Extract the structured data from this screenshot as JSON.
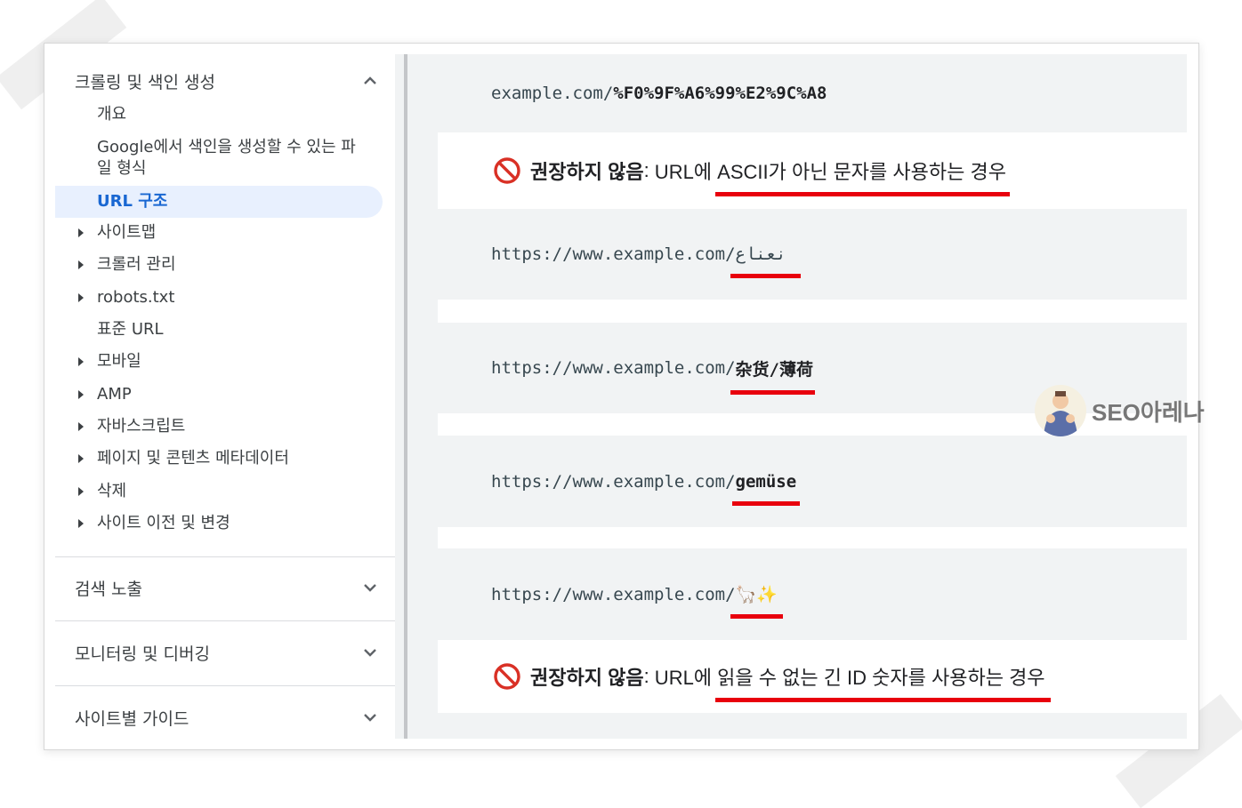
{
  "sidebar": {
    "section_crawl": "크롤링 및 색인 생성",
    "items": [
      {
        "label": "개요"
      },
      {
        "label": "Google에서 색인을 생성할 수 있는 파",
        "label2": "일 형식"
      },
      {
        "label": "URL 구조"
      },
      {
        "label": "사이트맵"
      },
      {
        "label": "크롤러 관리"
      },
      {
        "label": "robots.txt"
      },
      {
        "label": "표준 URL"
      },
      {
        "label": "모바일"
      },
      {
        "label": "AMP"
      },
      {
        "label": "자바스크립트"
      },
      {
        "label": "페이지 및 콘텐츠 메타데이터"
      },
      {
        "label": "삭제"
      },
      {
        "label": "사이트 이전 및 변경"
      }
    ],
    "section_search": "검색 노출",
    "section_monitor": "모니터링 및 디버깅",
    "section_guide": "사이트별 가이드"
  },
  "content": {
    "row1": {
      "prefix": "example.com/",
      "suffix": "%F0%9F%A6%99%E2%9C%A8"
    },
    "warn1": {
      "strong": "권장하지 않음",
      "colon": ":",
      "rest": " URL에 ASCII가 아닌 문자를 사용하는 경우"
    },
    "row2": {
      "prefix": "https://www.example.com/",
      "suffix": "نعناع"
    },
    "row3": {
      "prefix": "https://www.example.com/",
      "suffix": "杂货/薄荷"
    },
    "row4": {
      "prefix": "https://www.example.com/",
      "suffix": "gemüse"
    },
    "row5": {
      "prefix": "https://www.example.com/",
      "suffix": "🦙✨"
    },
    "warn2": {
      "strong": "권장하지 않음",
      "colon": ":",
      "rest": " URL에 읽을 수 없는 긴 ID 숫자를 사용하는 경우"
    }
  },
  "watermark": {
    "text": "SEO아레나"
  },
  "colors": {
    "accent": "#1967d2",
    "active_bg": "#e8f0fe",
    "underline": "#e8000d",
    "ban": "#d93025"
  },
  "icons": [
    "chevron-up-icon",
    "chevron-down-icon",
    "caret-right-icon",
    "ban-icon"
  ]
}
